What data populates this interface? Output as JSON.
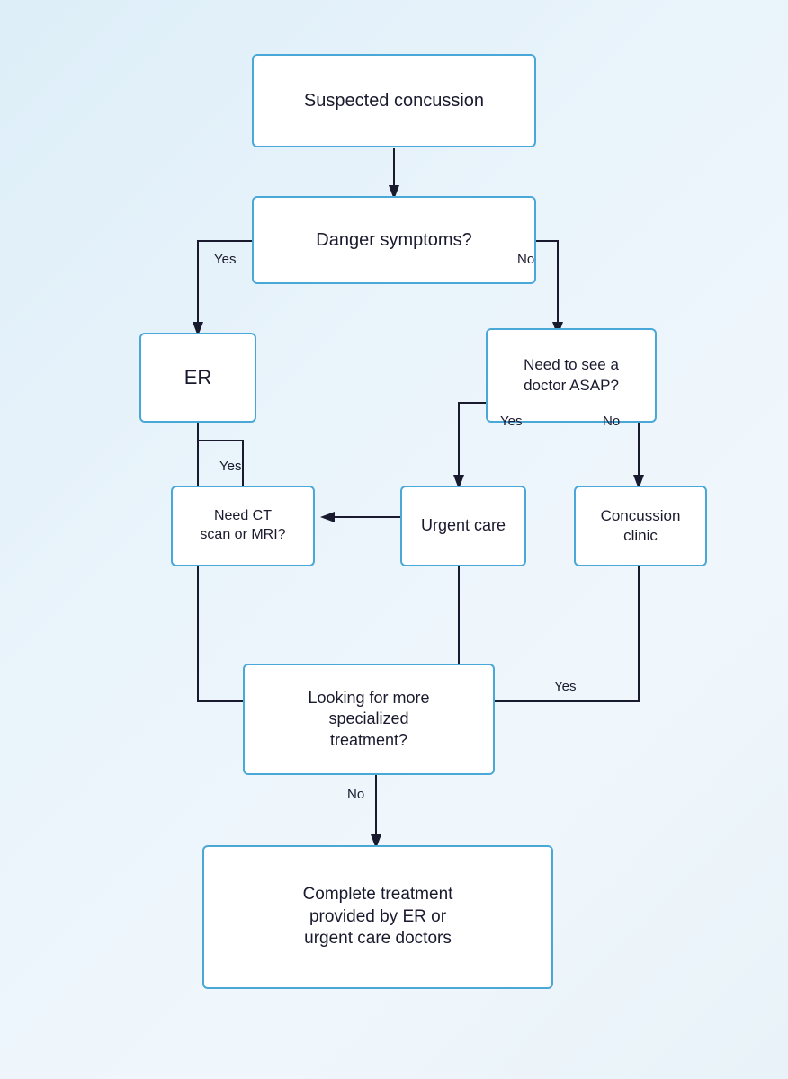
{
  "boxes": {
    "suspected_concussion": {
      "label": "Suspected concussion"
    },
    "danger_symptoms": {
      "label": "Danger symptoms?"
    },
    "er": {
      "label": "ER"
    },
    "need_to_see_doctor": {
      "label": "Need to see a\ndoctor ASAP?"
    },
    "need_ct": {
      "label": "Need CT\nscan or MRI?"
    },
    "urgent_care": {
      "label": "Urgent care"
    },
    "concussion_clinic": {
      "label": "Concussion\nclinic"
    },
    "looking_for_more": {
      "label": "Looking for more\nspecialized\ntreatment?"
    },
    "complete_treatment": {
      "label": "Complete treatment\nprovided by ER or\nurgent care doctors"
    }
  },
  "labels": {
    "yes1": "Yes",
    "no1": "No",
    "yes2": "Yes",
    "yes3": "Yes",
    "no2": "No",
    "no3": "No",
    "yes4": "Yes"
  }
}
